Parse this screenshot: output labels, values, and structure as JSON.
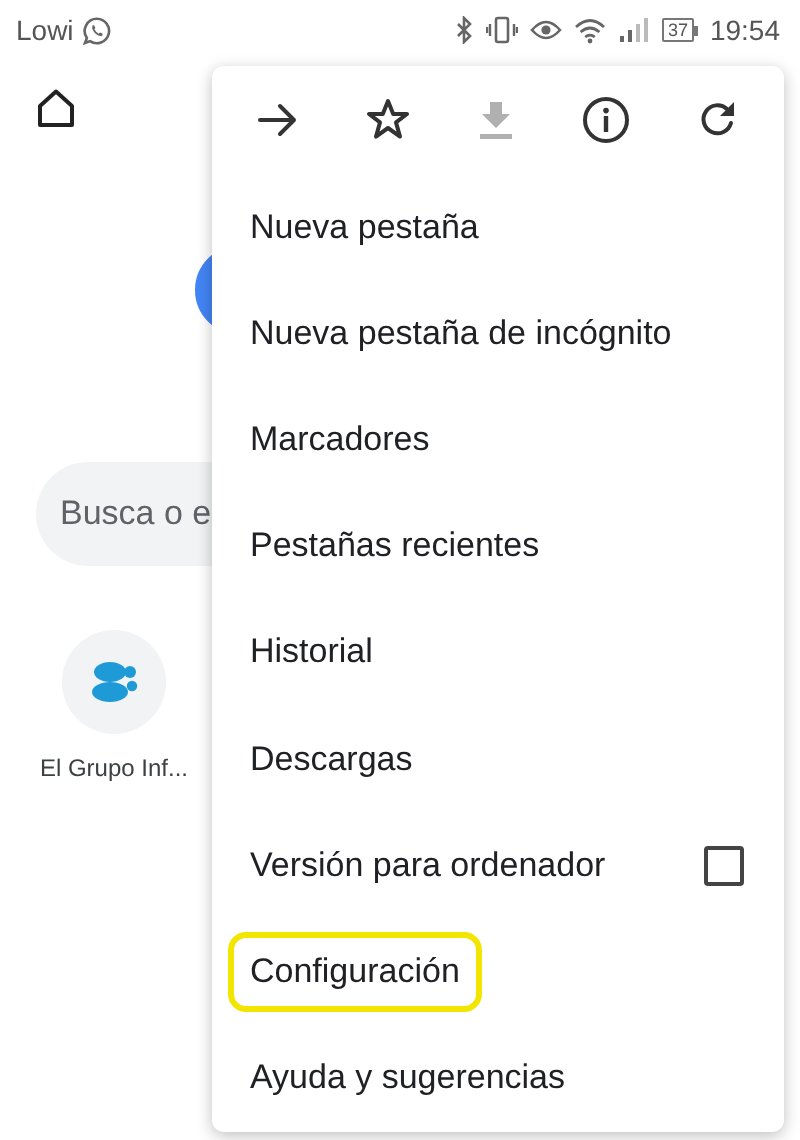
{
  "status_bar": {
    "carrier": "Lowi",
    "battery": "37",
    "time": "19:54"
  },
  "page": {
    "search": {
      "placeholder": "Busca o e"
    },
    "shortcuts": [
      {
        "label": "El Grupo Inf..."
      }
    ]
  },
  "menu": {
    "toolbar": [
      {
        "kind": "forward",
        "disabled": false
      },
      {
        "kind": "star",
        "disabled": false
      },
      {
        "kind": "download",
        "disabled": true
      },
      {
        "kind": "info",
        "disabled": false
      },
      {
        "kind": "reload",
        "disabled": false
      }
    ],
    "items": [
      {
        "label": "Nueva pestaña",
        "kind": "plain",
        "highlighted": false
      },
      {
        "label": "Nueva pestaña de incógnito",
        "kind": "plain",
        "highlighted": false
      },
      {
        "label": "Marcadores",
        "kind": "plain",
        "highlighted": false
      },
      {
        "label": "Pestañas recientes",
        "kind": "plain",
        "highlighted": false
      },
      {
        "label": "Historial",
        "kind": "plain",
        "highlighted": false
      },
      {
        "label": "Descargas",
        "kind": "plain",
        "highlighted": false
      },
      {
        "label": "Versión para ordenador",
        "kind": "checkbox",
        "checked": false,
        "highlighted": false
      },
      {
        "label": "Configuración",
        "kind": "plain",
        "highlighted": true
      },
      {
        "label": "Ayuda y sugerencias",
        "kind": "plain",
        "highlighted": false
      }
    ]
  }
}
